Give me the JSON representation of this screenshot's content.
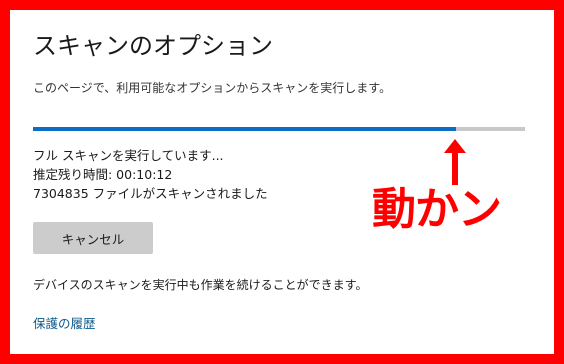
{
  "page": {
    "title": "スキャンのオプション",
    "description": "このページで、利用可能なオプションからスキャンを実行します。"
  },
  "progress": {
    "fraction": 0.86,
    "fill_color": "#0a6ec4",
    "track_color": "#c8c8c8"
  },
  "status": {
    "line1": "フル スキャンを実行しています...",
    "line2": "推定残り時間: 00:10:12",
    "line3": "7304835 ファイルがスキャンされました"
  },
  "actions": {
    "cancel_label": "キャンセル"
  },
  "note": "デバイスのスキャンを実行中も作業を続けることができます。",
  "links": {
    "history": "保護の履歴"
  },
  "annotation": {
    "text": "動かン",
    "color": "#ff0000",
    "arrow_icon": "up-arrow-icon"
  }
}
